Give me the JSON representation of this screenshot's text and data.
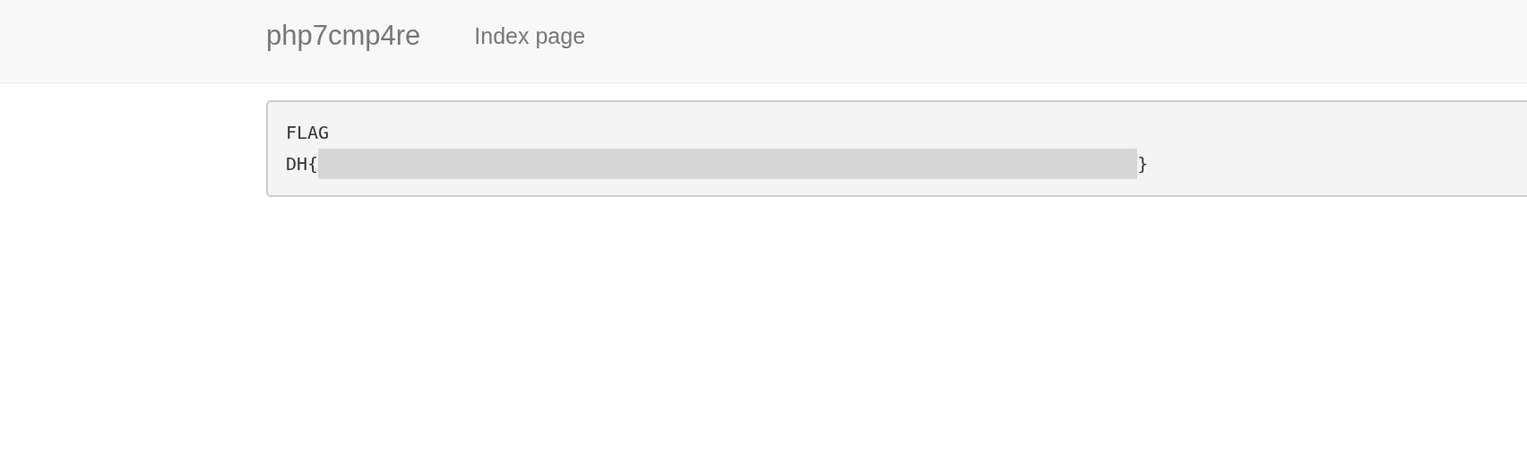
{
  "navbar": {
    "brand": "php7cmp4re",
    "links": [
      {
        "label": "Index page"
      }
    ]
  },
  "output": {
    "label": "FLAG",
    "prefix": "DH{",
    "suffix": "}",
    "redacted": true
  }
}
